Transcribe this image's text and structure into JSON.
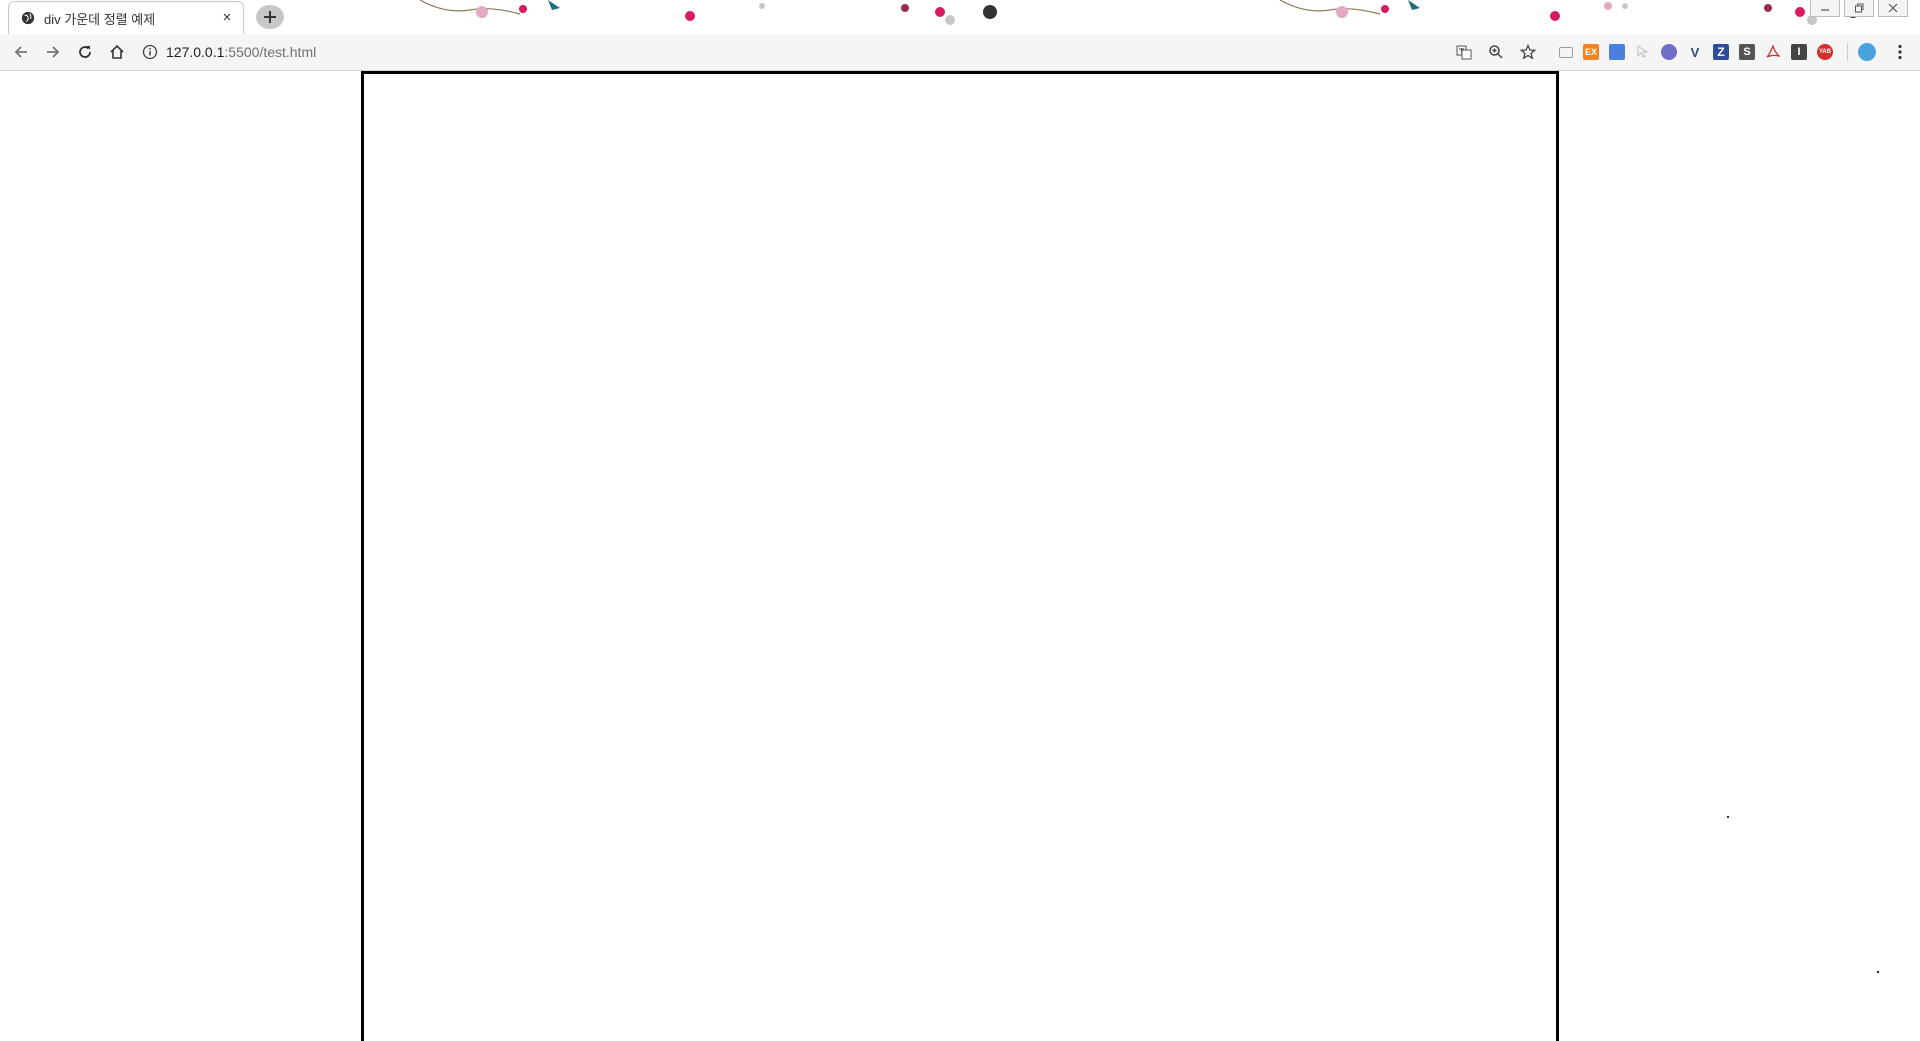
{
  "browser": {
    "tab": {
      "title": "div 가운데 정렬 예제",
      "close_label": "×",
      "favicon": "globe-icon"
    },
    "new_tab_icon": "plus-icon",
    "window_controls": [
      "minimize-icon",
      "restore-icon",
      "close-icon"
    ]
  },
  "toolbar": {
    "back_icon": "arrow-left-icon",
    "forward_icon": "arrow-right-icon",
    "reload_icon": "reload-icon",
    "home_icon": "home-icon",
    "url_host": "127.0.0.1",
    "url_rest": ":5500/test.html",
    "omnibox_actions": [
      "translate-icon",
      "zoom-icon",
      "bookmark-star-icon"
    ],
    "extensions": [
      {
        "name": "cast-icon",
        "label": "",
        "color": "#9e9e9e"
      },
      {
        "name": "ex-extension-icon",
        "label": "EX",
        "color": "#f58220"
      },
      {
        "name": "translate-extension-icon",
        "label": "",
        "color": "#4a7fe0"
      },
      {
        "name": "cursor-extension-icon",
        "label": "",
        "color": "#bdbdbd"
      },
      {
        "name": "web-extension-icon",
        "label": "",
        "color": "#6f6fc9"
      },
      {
        "name": "v-extension-icon",
        "label": "V",
        "color": "#2b4f86"
      },
      {
        "name": "z-extension-icon",
        "label": "Z",
        "color": "#2e4b9c"
      },
      {
        "name": "s-extension-icon",
        "label": "S",
        "color": "#555555"
      },
      {
        "name": "pdf-extension-icon",
        "label": "",
        "color": "#c0392b"
      },
      {
        "name": "i-extension-icon",
        "label": "I",
        "color": "#444444"
      },
      {
        "name": "yab-extension-icon",
        "label": "YAB",
        "color": "#d32f2f"
      }
    ],
    "profile_color": "#4aa3df",
    "menu_icon": "kebab-menu-icon"
  },
  "page": {
    "box_border_color": "#000000"
  }
}
